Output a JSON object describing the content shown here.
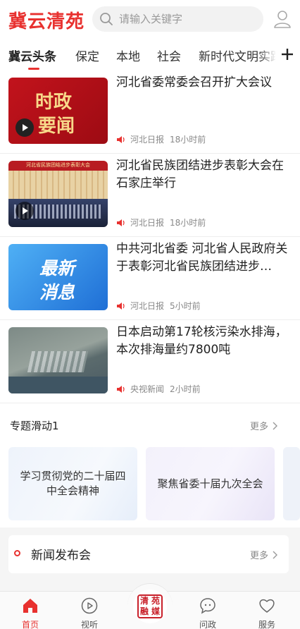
{
  "header": {
    "logo": "冀云清苑",
    "search_placeholder": "请输入关键字"
  },
  "tabs": [
    {
      "label": "冀云头条",
      "active": true
    },
    {
      "label": "保定",
      "active": false
    },
    {
      "label": "本地",
      "active": false
    },
    {
      "label": "社会",
      "active": false
    },
    {
      "label": "新时代文明实践",
      "active": false
    }
  ],
  "news": [
    {
      "title": "河北省委常委会召开扩大会议",
      "source": "河北日报",
      "time": "18小时前",
      "thumb_text": [
        "时政",
        "要闻"
      ],
      "has_video": true
    },
    {
      "title": "河北省民族团结进步表彰大会在石家庄举行",
      "source": "河北日报",
      "time": "18小时前",
      "thumb_banner": "河北省民族团结进步表彰大会",
      "has_video": true
    },
    {
      "title": "中共河北省委 河北省人民政府关于表彰河北省民族团结进步…",
      "source": "河北日报",
      "time": "5小时前",
      "thumb_text": [
        "最新",
        "消息"
      ],
      "has_video": false
    },
    {
      "title": "日本启动第17轮核污染水排海，本次排海量约7800吨",
      "source": "央视新闻",
      "time": "2小时前",
      "has_video": false
    }
  ],
  "topics": {
    "header": "专题滑动1",
    "more": "更多",
    "cards": [
      {
        "title": "学习贯彻党的二十届四中全会精神"
      },
      {
        "title": "聚焦省委十届九次全会"
      }
    ]
  },
  "press": {
    "title": "新闻发布会",
    "more": "更多"
  },
  "bottom_nav": [
    {
      "label": "首页",
      "icon": "home-icon",
      "active": true
    },
    {
      "label": "视听",
      "icon": "play-circle-icon",
      "active": false
    },
    {
      "label": "问政",
      "icon": "chat-icon",
      "active": false
    },
    {
      "label": "服务",
      "icon": "heart-icon",
      "active": false
    }
  ],
  "center_logo_text": [
    "清",
    "苑",
    "融",
    "媒"
  ],
  "colors": {
    "accent": "#e8312f",
    "blue_card": "#2a8de8",
    "red_card": "#b8121b"
  }
}
